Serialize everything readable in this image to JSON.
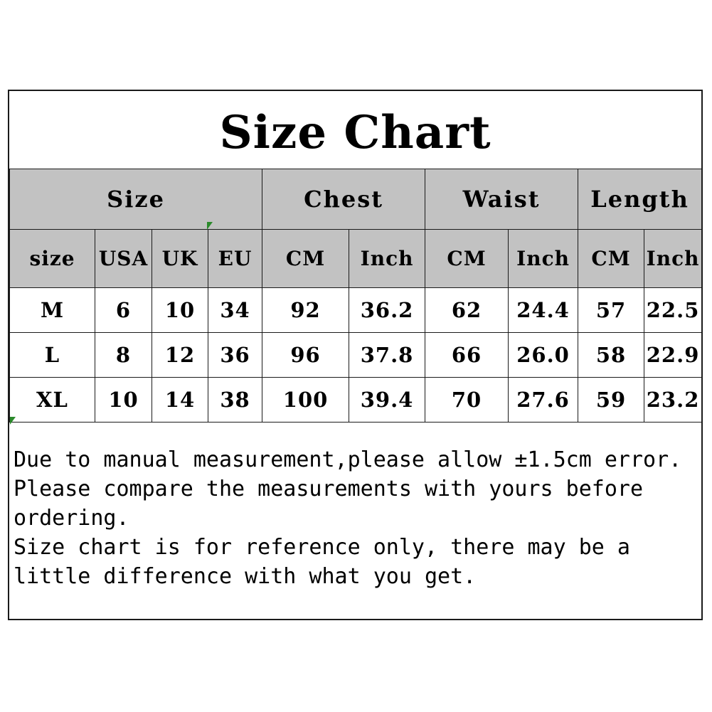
{
  "chart_data": {
    "type": "table",
    "title": "Size Chart",
    "group_headers": [
      {
        "label": "Size",
        "span": 4
      },
      {
        "label": "Chest",
        "span": 2
      },
      {
        "label": "Waist",
        "span": 2
      },
      {
        "label": "Length",
        "span": 2
      }
    ],
    "columns": [
      "size",
      "USA",
      "UK",
      "EU",
      "CM",
      "Inch",
      "CM",
      "Inch",
      "CM",
      "Inch"
    ],
    "rows": [
      [
        "M",
        "6",
        "10",
        "34",
        "92",
        "36.2",
        "62",
        "24.4",
        "57",
        "22.5"
      ],
      [
        "L",
        "8",
        "12",
        "36",
        "96",
        "37.8",
        "66",
        "26.0",
        "58",
        "22.9"
      ],
      [
        "XL",
        "10",
        "14",
        "38",
        "100",
        "39.4",
        "70",
        "27.6",
        "59",
        "23.2"
      ]
    ],
    "notes": [
      "Due to manual measurement,please allow ±1.5cm error.",
      "Please compare the measurements with yours before ordering.",
      "Size chart is for reference only, there may be a little difference with what you get."
    ],
    "colors": {
      "header_background": "#c2c2c2",
      "cell_background": "#ffffff",
      "border": "#1a1a1a",
      "text": "#000000",
      "speck": "#2b8a2b"
    }
  }
}
